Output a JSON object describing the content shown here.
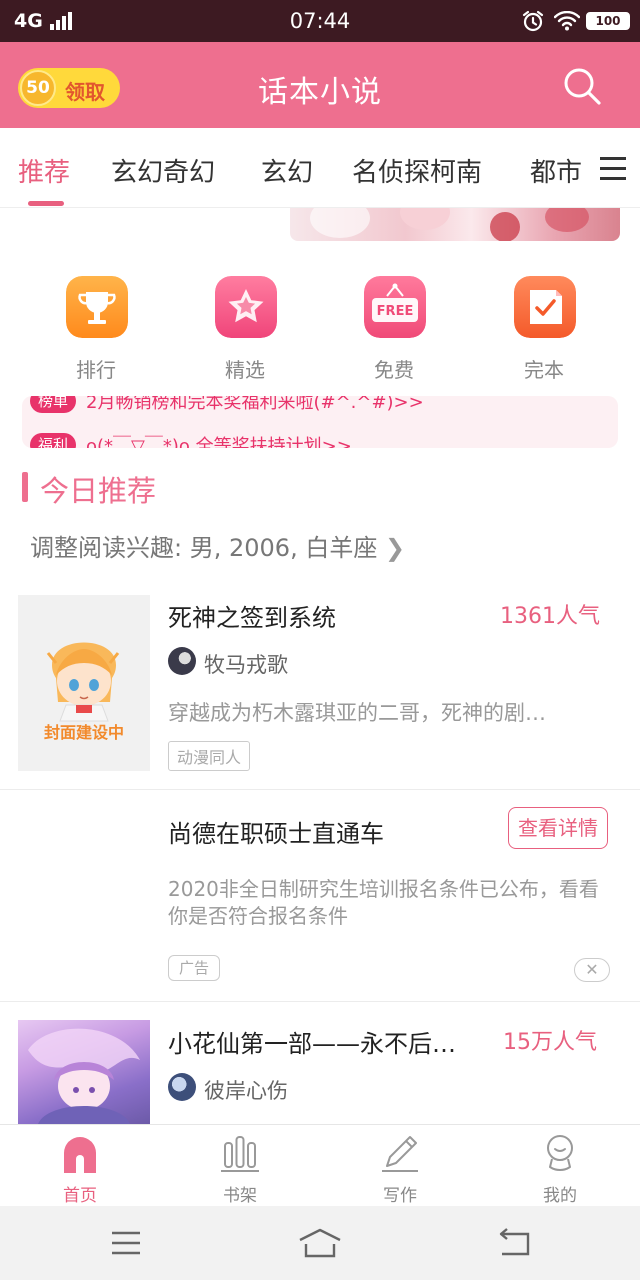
{
  "status_bar": {
    "carrier": "4G",
    "time": "07:44",
    "battery": "100"
  },
  "header": {
    "coin_amount": "50",
    "claim_label": "领取",
    "title": "话本小说"
  },
  "tabs": [
    {
      "label": "推荐",
      "active": true
    },
    {
      "label": "玄幻奇幻",
      "active": false
    },
    {
      "label": "玄幻",
      "active": false
    },
    {
      "label": "名侦探柯南",
      "active": false
    },
    {
      "label": "都市",
      "active": false
    }
  ],
  "quick_entries": [
    {
      "label": "排行",
      "icon": "trophy-icon"
    },
    {
      "label": "精选",
      "icon": "star-icon"
    },
    {
      "label": "免费",
      "icon": "free-sign-icon",
      "icon_text": "FREE"
    },
    {
      "label": "完本",
      "icon": "completed-book-icon"
    }
  ],
  "notices": [
    {
      "tag": "榜单",
      "text": "2月畅销榜和完本奖福利来啦(#^.^#)>>"
    },
    {
      "tag": "福利",
      "text": "o(*￣▽￣*)o 全等奖扶持计划>>"
    }
  ],
  "section": {
    "title": "今日推荐",
    "interest_prefix": "调整阅读兴趣:",
    "interest_value": "男, 2006, 白羊座"
  },
  "books": [
    {
      "title": "死神之签到系统",
      "popularity": "1361人气",
      "author": "牧马戎歌",
      "description": "穿越成为朽木露琪亚的二哥，死神的剧…",
      "genre": "动漫同人",
      "cover_text": "封面建设中"
    },
    {
      "title": "小花仙第一部——永不后…",
      "popularity": "15万人气",
      "author": "彼岸心伤"
    }
  ],
  "ad": {
    "title": "尚德在职硕士直通车",
    "button": "查看详情",
    "description": "2020非全日制研究生培训报名条件已公布，看看你是否符合报名条件",
    "tag": "广告",
    "close": "✕"
  },
  "bottom_nav": [
    {
      "label": "首页",
      "icon": "home-icon",
      "active": true
    },
    {
      "label": "书架",
      "icon": "bookshelf-icon",
      "active": false
    },
    {
      "label": "写作",
      "icon": "pencil-icon",
      "active": false
    },
    {
      "label": "我的",
      "icon": "profile-icon",
      "active": false
    }
  ],
  "colors": {
    "brand": "#ee6f8f",
    "accent": "#e8607f",
    "status_bar": "#3d1a22",
    "coin": "#ffd93b"
  }
}
